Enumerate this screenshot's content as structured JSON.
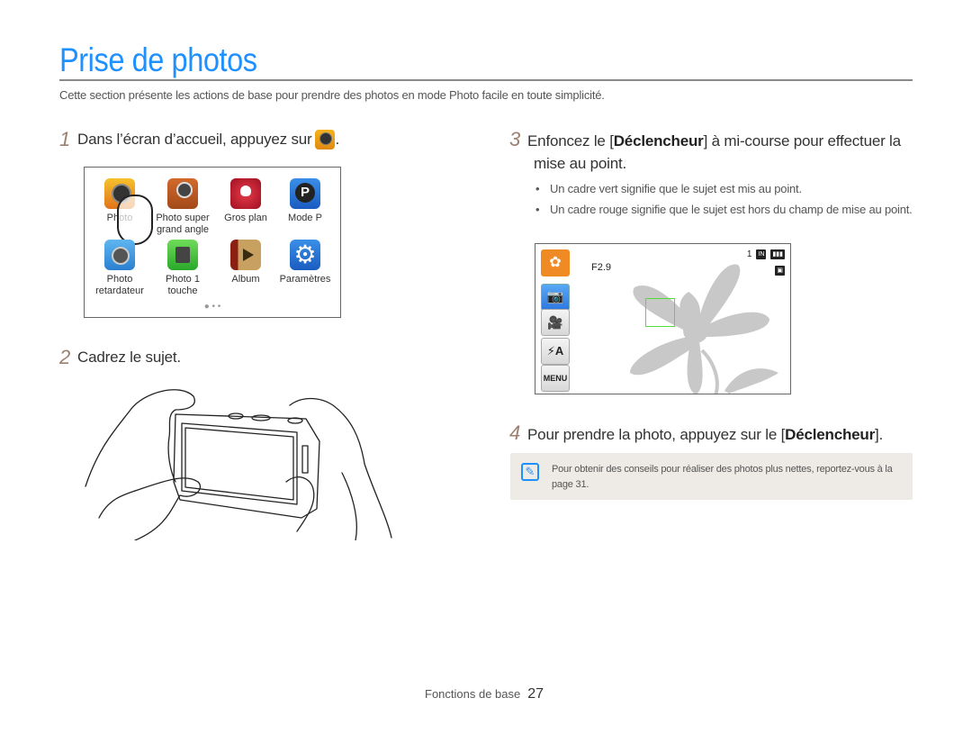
{
  "page": {
    "title": "Prise de photos",
    "intro": "Cette section présente les actions de base pour prendre des photos en mode Photo facile en toute simplicité.",
    "accent_color": "#1e90ff"
  },
  "steps": [
    {
      "number": "1",
      "text": "Dans l’écran d’accueil, appuyez sur",
      "icon": "photo-app-icon",
      "suffix": "."
    },
    {
      "number": "2",
      "text": "Cadrez le sujet."
    },
    {
      "number": "3",
      "text_before": "Enfoncez le [",
      "bold": "Déclencheur",
      "text_after": "] à mi-course pour effectuer la",
      "text_line2": "mise au point.",
      "bullets": [
        "Un cadre vert signifie que le sujet est mis au point.",
        "Un cadre rouge signifie que le sujet est hors du champ de mise au point."
      ]
    },
    {
      "number": "4",
      "text_before": "Pour prendre la photo, appuyez sur le [",
      "bold": "Déclencheur",
      "text_after": "]."
    }
  ],
  "home_screen": {
    "apps": [
      {
        "label": "Photo",
        "icon": "camera-lens-icon"
      },
      {
        "label": "Photo super grand angle",
        "icon": "panorama-icon"
      },
      {
        "label": "Gros plan",
        "icon": "macro-flower-icon"
      },
      {
        "label": "Mode P",
        "icon": "program-mode-icon"
      },
      {
        "label": "Photo retardateur",
        "icon": "self-timer-icon"
      },
      {
        "label": "Photo 1 touche",
        "icon": "one-touch-icon"
      },
      {
        "label": "Album",
        "icon": "album-icon"
      },
      {
        "label": "Paramètres",
        "icon": "settings-gear-icon"
      }
    ],
    "pager": "● • •"
  },
  "camera_lcd": {
    "aperture": "F2.9",
    "shot_count": "1",
    "memory_icon": "IN",
    "battery_icon": "battery-full-icon",
    "mode_buttons": {
      "macro": "macro-flower-icon",
      "photo": "camera-icon",
      "video": "video-camera-icon",
      "flash": "⚡A",
      "menu": "MENU"
    },
    "focus_frame_color": "#4ee036"
  },
  "note": {
    "icon": "note-pencil-icon",
    "text": "Pour obtenir des conseils pour réaliser des photos plus nettes, reportez-vous à la page 31."
  },
  "footer": {
    "section": "Fonctions de base",
    "page_number": "27"
  }
}
